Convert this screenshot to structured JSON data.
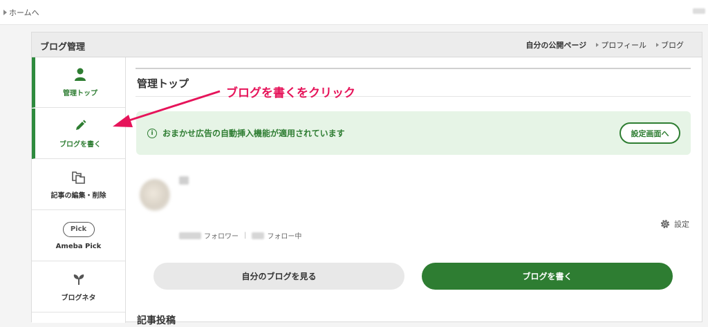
{
  "topbar": {
    "home_link": "ホームへ"
  },
  "panel": {
    "title": "ブログ管理",
    "links": {
      "public_page": "自分の公開ページ",
      "profile": "プロフィール",
      "blog": "ブログ"
    }
  },
  "sidebar": {
    "items": [
      {
        "label": "管理トップ",
        "icon": "person-icon",
        "active": true
      },
      {
        "label": "ブログを書く",
        "icon": "pencil-icon",
        "active": true
      },
      {
        "label": "記事の編集・削除",
        "icon": "pages-icon",
        "active": false
      },
      {
        "label": "Ameba Pick",
        "icon": "pick-badge-icon",
        "badge": "Pick",
        "active": false
      },
      {
        "label": "ブログネタ",
        "icon": "sprout-icon",
        "active": false
      }
    ]
  },
  "main": {
    "title": "管理トップ",
    "notice": {
      "text": "おまかせ広告の自動挿入機能が適用されています",
      "button": "設定画面へ",
      "icon_glyph": "i"
    },
    "profile": {
      "follower_label": "フォロワー",
      "following_label": "フォロー中",
      "settings_label": "設定"
    },
    "buttons": {
      "view_blog": "自分のブログを見る",
      "write_blog": "ブログを書く"
    },
    "section_title": "記事投稿"
  },
  "annotation": {
    "text": "ブログを書くをクリック",
    "color": "#e6145a"
  },
  "colors": {
    "accent_green": "#2e7d32",
    "notice_bg": "#e6f4e6",
    "annotation": "#e6145a"
  }
}
